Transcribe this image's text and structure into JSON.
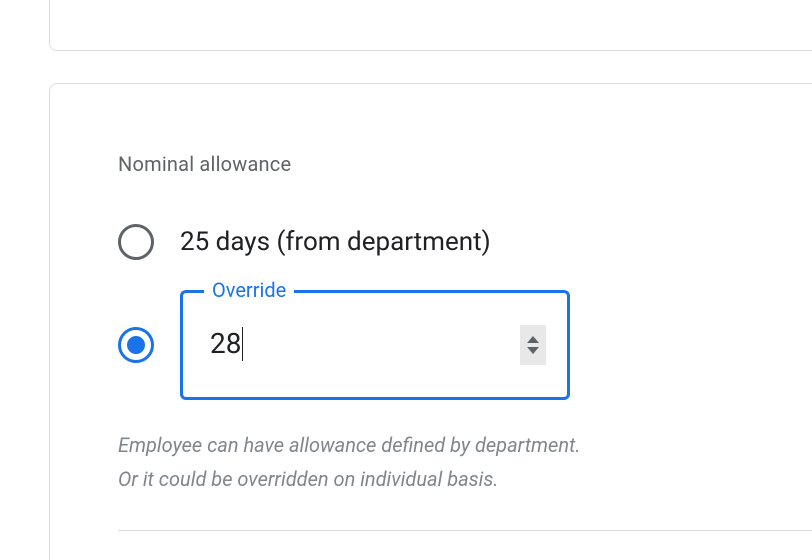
{
  "section": {
    "title": "Nominal allowance",
    "helper_line1": "Employee can have allowance defined by department.",
    "helper_line2": "Or it could be overridden on individual basis."
  },
  "options": {
    "department": {
      "label": "25 days (from department)",
      "selected": false
    },
    "override": {
      "field_label": "Override",
      "value": "28",
      "selected": true
    }
  }
}
